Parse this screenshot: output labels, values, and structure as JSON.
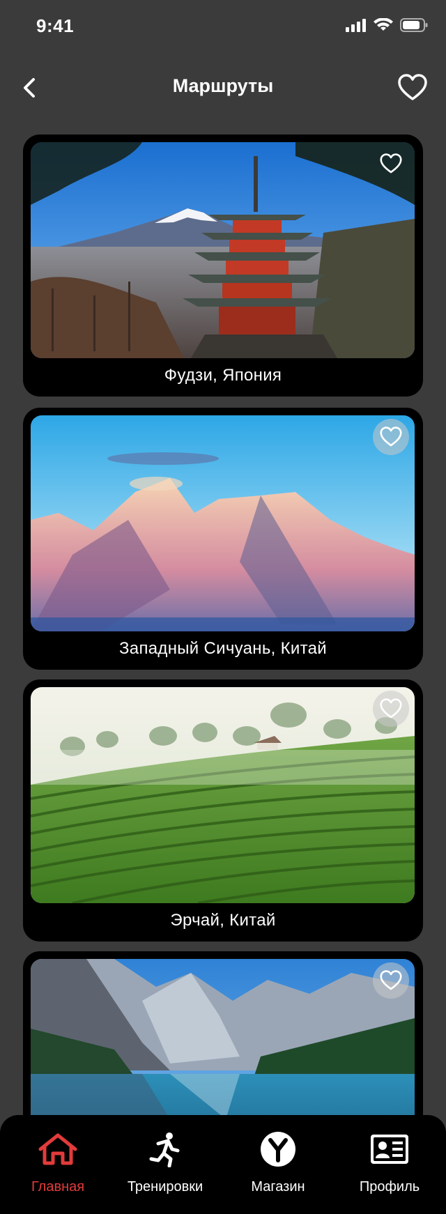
{
  "status_bar": {
    "time": "9:41"
  },
  "header": {
    "title": "Маршруты"
  },
  "routes": [
    {
      "name": "Фудзи, Япония",
      "favorited": false
    },
    {
      "name": "Западный Сичуань, Китай",
      "favorited": false
    },
    {
      "name": "Эрчай, Китай",
      "favorited": false
    },
    {
      "name": "",
      "favorited": false
    }
  ],
  "tabbar": {
    "items": [
      {
        "label": "Главная",
        "icon": "home-icon",
        "active": true
      },
      {
        "label": "Тренировки",
        "icon": "running-icon",
        "active": false
      },
      {
        "label": "Магазин",
        "icon": "store-y-icon",
        "active": false
      },
      {
        "label": "Профиль",
        "icon": "profile-card-icon",
        "active": false
      }
    ]
  },
  "colors": {
    "background": "#3b3b3b",
    "card": "#000000",
    "accent": "#e23b3b"
  }
}
